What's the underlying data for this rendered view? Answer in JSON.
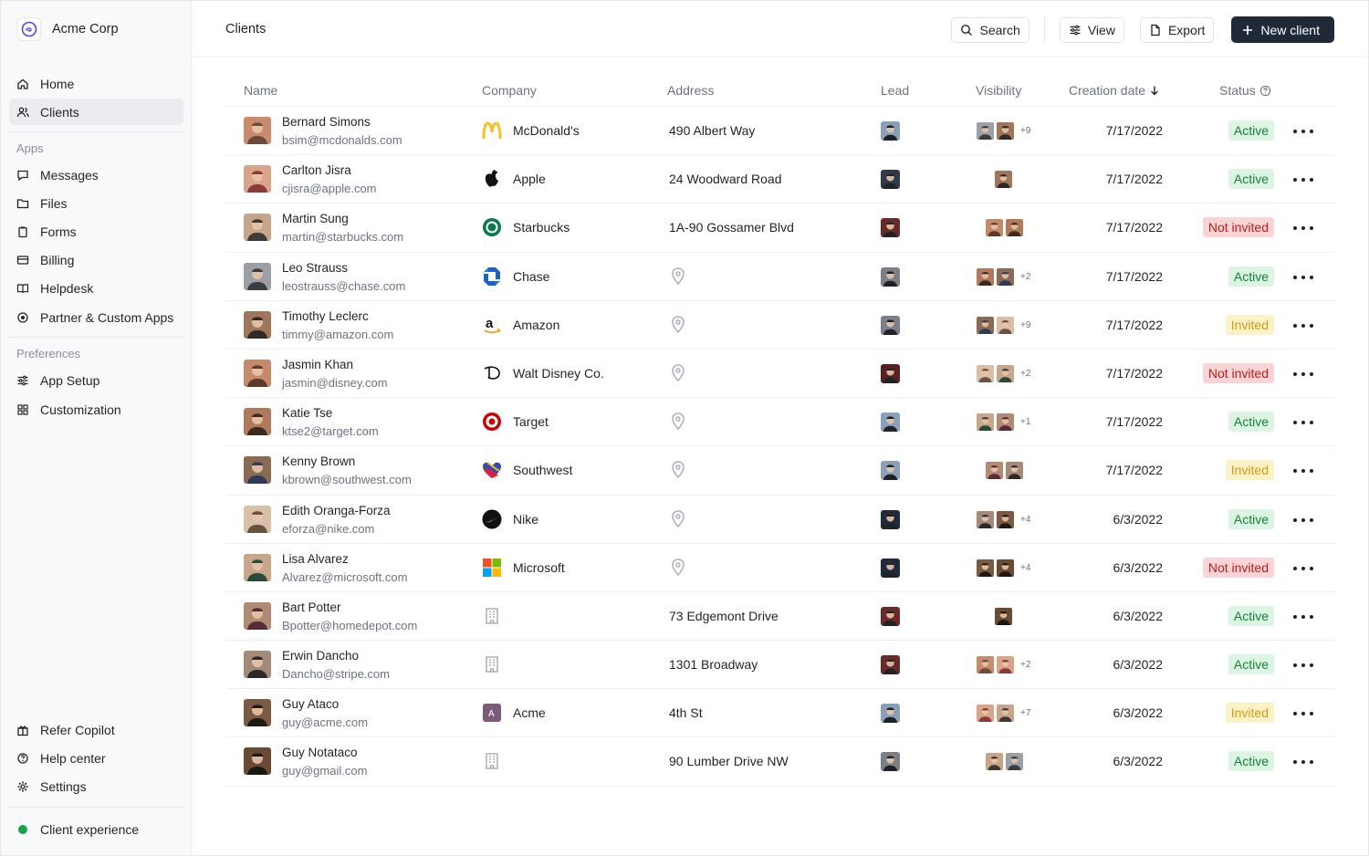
{
  "brand": {
    "name": "Acme Corp"
  },
  "sidebar": {
    "nav": [
      {
        "label": "Home",
        "icon": "home-icon"
      },
      {
        "label": "Clients",
        "icon": "users-icon",
        "active": true
      }
    ],
    "apps_label": "Apps",
    "apps": [
      {
        "label": "Messages",
        "icon": "message-icon"
      },
      {
        "label": "Files",
        "icon": "folder-icon"
      },
      {
        "label": "Forms",
        "icon": "clipboard-icon"
      },
      {
        "label": "Billing",
        "icon": "credit-card-icon"
      },
      {
        "label": "Helpdesk",
        "icon": "book-icon"
      },
      {
        "label": "Partner & Custom Apps",
        "icon": "target-icon"
      }
    ],
    "preferences_label": "Preferences",
    "preferences": [
      {
        "label": "App Setup",
        "icon": "sliders-icon"
      },
      {
        "label": "Customization",
        "icon": "grid-icon"
      }
    ],
    "footer": [
      {
        "label": "Refer Copilot",
        "icon": "gift-icon"
      },
      {
        "label": "Help center",
        "icon": "help-icon"
      },
      {
        "label": "Settings",
        "icon": "gear-icon"
      }
    ],
    "client_experience": "Client experience"
  },
  "header": {
    "title": "Clients",
    "search": "Search",
    "view": "View",
    "export": "Export",
    "new_client": "New client"
  },
  "table": {
    "columns": {
      "name": "Name",
      "company": "Company",
      "address": "Address",
      "lead": "Lead",
      "visibility": "Visibility",
      "creation_date": "Creation date",
      "status": "Status"
    },
    "rows": [
      {
        "name": "Bernard Simons",
        "email": "bsim@mcdonalds.com",
        "company": "McDonald's",
        "logo": "mcdonalds",
        "address": "490 Albert Way",
        "date": "7/17/2022",
        "status": "Active",
        "more": "+9",
        "vis": 2
      },
      {
        "name": "Carlton Jisra",
        "email": "cjisra@apple.com",
        "company": "Apple",
        "logo": "apple",
        "address": "24 Woodward Road",
        "date": "7/17/2022",
        "status": "Active",
        "more": "",
        "vis": 1
      },
      {
        "name": "Martin Sung",
        "email": "martin@starbucks.com",
        "company": "Starbucks",
        "logo": "starbucks",
        "address": "1A-90 Gossamer Blvd",
        "date": "7/17/2022",
        "status": "Not invited",
        "more": "",
        "vis": 2
      },
      {
        "name": "Leo Strauss",
        "email": "leostrauss@chase.com",
        "company": "Chase",
        "logo": "chase",
        "address": "",
        "date": "7/17/2022",
        "status": "Active",
        "more": "+2",
        "vis": 2
      },
      {
        "name": "Timothy Leclerc",
        "email": "timmy@amazon.com",
        "company": "Amazon",
        "logo": "amazon",
        "address": "",
        "date": "7/17/2022",
        "status": "Invited",
        "more": "+9",
        "vis": 2
      },
      {
        "name": "Jasmin Khan",
        "email": "jasmin@disney.com",
        "company": "Walt Disney Co.",
        "logo": "disney",
        "address": "",
        "date": "7/17/2022",
        "status": "Not invited",
        "more": "+2",
        "vis": 2
      },
      {
        "name": "Katie Tse",
        "email": "ktse2@target.com",
        "company": "Target",
        "logo": "target",
        "address": "",
        "date": "7/17/2022",
        "status": "Active",
        "more": "+1",
        "vis": 2
      },
      {
        "name": "Kenny Brown",
        "email": "kbrown@southwest.com",
        "company": "Southwest",
        "logo": "southwest",
        "address": "",
        "date": "7/17/2022",
        "status": "Invited",
        "more": "",
        "vis": 2
      },
      {
        "name": "Edith Oranga-Forza",
        "email": "eforza@nike.com",
        "company": "Nike",
        "logo": "nike",
        "address": "",
        "date": "6/3/2022",
        "status": "Active",
        "more": "+4",
        "vis": 2
      },
      {
        "name": "Lisa Alvarez",
        "email": "Alvarez@microsoft.com",
        "company": "Microsoft",
        "logo": "microsoft",
        "address": "",
        "date": "6/3/2022",
        "status": "Not invited",
        "more": "+4",
        "vis": 2
      },
      {
        "name": "Bart Potter",
        "email": "Bpotter@homedepot.com",
        "company": "",
        "logo": "building",
        "address": "73 Edgemont Drive",
        "date": "6/3/2022",
        "status": "Active",
        "more": "",
        "vis": 1
      },
      {
        "name": "Erwin Dancho",
        "email": "Dancho@stripe.com",
        "company": "",
        "logo": "building",
        "address": "1301 Broadway",
        "date": "6/3/2022",
        "status": "Active",
        "more": "+2",
        "vis": 2
      },
      {
        "name": "Guy Ataco",
        "email": "guy@acme.com",
        "company": "Acme",
        "logo": "acme",
        "address": "4th St",
        "date": "6/3/2022",
        "status": "Invited",
        "more": "+7",
        "vis": 2
      },
      {
        "name": "Guy Notataco",
        "email": "guy@gmail.com",
        "company": "",
        "logo": "building",
        "address": "90 Lumber Drive NW",
        "date": "6/3/2022",
        "status": "Active",
        "more": "",
        "vis": 2
      }
    ]
  },
  "colors": {
    "primary": "#1f2937",
    "active_bg": "#dcf5e3",
    "active_fg": "#15803d",
    "invited_bg": "#fdf1c7",
    "invited_fg": "#d49b12",
    "not_invited_bg": "#fbd5d5",
    "not_invited_fg": "#b91c1c"
  }
}
